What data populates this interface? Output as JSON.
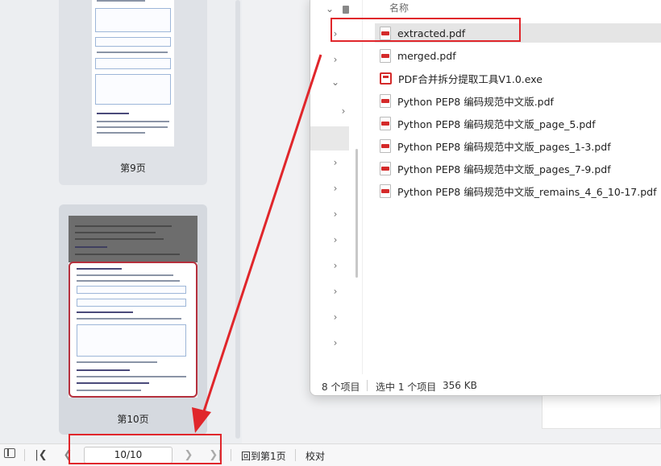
{
  "viewer": {
    "thumbnails": [
      {
        "label": "第9页"
      },
      {
        "label": "第10页"
      }
    ],
    "bottombar": {
      "page_indicator": "10/10",
      "back_to_first": "回到第1页",
      "proofread": "校对"
    }
  },
  "explorer": {
    "column_name": "名称",
    "files": [
      {
        "name": "extracted.pdf",
        "type": "pdf",
        "selected": true
      },
      {
        "name": "merged.pdf",
        "type": "pdf"
      },
      {
        "name": "PDF合并拆分提取工具V1.0.exe",
        "type": "exe"
      },
      {
        "name": "Python PEP8 编码规范中文版.pdf",
        "type": "pdf"
      },
      {
        "name": "Python PEP8 编码规范中文版_page_5.pdf",
        "type": "pdf"
      },
      {
        "name": "Python PEP8 编码规范中文版_pages_1-3.pdf",
        "type": "pdf"
      },
      {
        "name": "Python PEP8 编码规范中文版_pages_7-9.pdf",
        "type": "pdf"
      },
      {
        "name": "Python PEP8 编码规范中文版_remains_4_6_10-17.pdf",
        "type": "pdf"
      }
    ],
    "status": {
      "item_count": "8 个项目",
      "selected": "选中 1 个项目",
      "size": "356 KB"
    }
  },
  "colors": {
    "annotation": "#e0262b",
    "selected_page_border": "#b5303d",
    "pdf_icon": "#d42a2a"
  }
}
